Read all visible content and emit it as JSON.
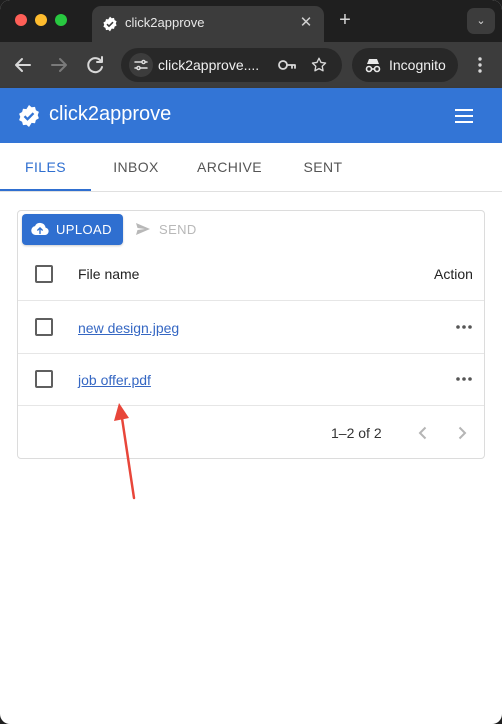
{
  "browser": {
    "tab_title": "click2approve",
    "tab_close": "✕",
    "new_tab": "+",
    "tab_search": "⌄",
    "url": "click2approve....",
    "incognito_label": "Incognito"
  },
  "app": {
    "title": "click2approve",
    "brand_color": "#3375d6"
  },
  "nav": {
    "tabs": [
      {
        "label": "FILES",
        "active": true
      },
      {
        "label": "INBOX",
        "active": false
      },
      {
        "label": "ARCHIVE",
        "active": false
      },
      {
        "label": "SENT",
        "active": false
      }
    ]
  },
  "files": {
    "upload_label": "UPLOAD",
    "send_label": "SEND",
    "columns": {
      "name": "File name",
      "action": "Action"
    },
    "rows": [
      {
        "name": "new design.jpeg"
      },
      {
        "name": "job offer.pdf"
      }
    ],
    "pagination": "1–2 of 2"
  },
  "annotation": {
    "color": "#e8463a",
    "target": "job offer.pdf"
  }
}
